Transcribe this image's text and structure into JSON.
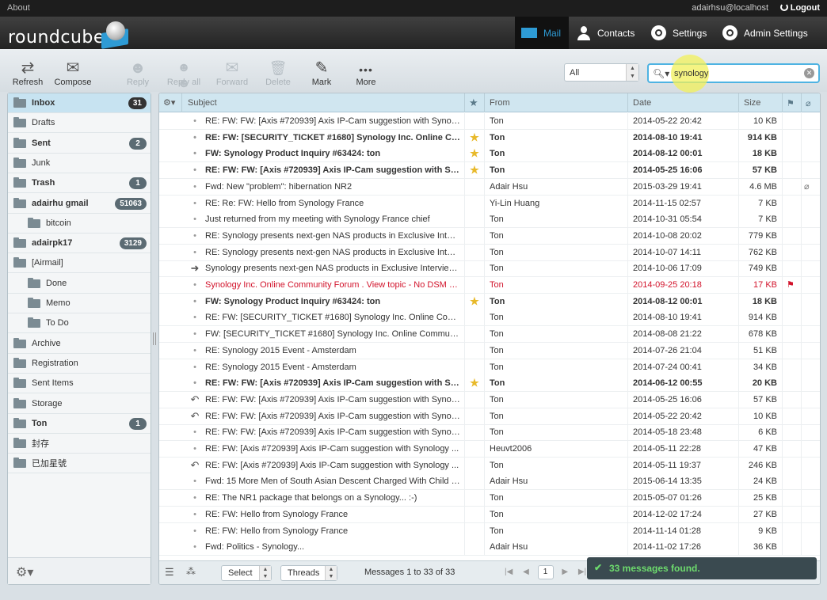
{
  "topbar": {
    "about": "About",
    "user": "adairhsu@localhost",
    "logout": "Logout"
  },
  "header": {
    "logo": "roundcube",
    "nav": [
      {
        "label": "Mail",
        "icon": "mail-icon",
        "active": true
      },
      {
        "label": "Contacts",
        "icon": "person-icon"
      },
      {
        "label": "Settings",
        "icon": "gear-icon"
      },
      {
        "label": "Admin Settings",
        "icon": "gear-icon"
      }
    ]
  },
  "toolbar": {
    "refresh": "Refresh",
    "compose": "Compose",
    "reply": "Reply",
    "reply_all": "Reply all",
    "forward": "Forward",
    "delete": "Delete",
    "mark": "Mark",
    "more": "More"
  },
  "filter": {
    "value": "All"
  },
  "search": {
    "value": "synology"
  },
  "folders": [
    {
      "name": "Inbox",
      "count": "31",
      "bold": true,
      "sel": true
    },
    {
      "name": "Drafts"
    },
    {
      "name": "Sent",
      "count": "2",
      "bold": true
    },
    {
      "name": "Junk"
    },
    {
      "name": "Trash",
      "count": "1",
      "bold": true
    },
    {
      "name": "adairhu gmail",
      "count": "51063",
      "bold": true
    },
    {
      "name": "bitcoin",
      "sub": true
    },
    {
      "name": "adairpk17",
      "count": "3129",
      "bold": true
    },
    {
      "name": "[Airmail]"
    },
    {
      "name": "Done",
      "sub": true
    },
    {
      "name": "Memo",
      "sub": true
    },
    {
      "name": "To Do",
      "sub": true
    },
    {
      "name": "Archive"
    },
    {
      "name": "Registration"
    },
    {
      "name": "Sent Items"
    },
    {
      "name": "Storage"
    },
    {
      "name": "Ton",
      "count": "1",
      "bold": true
    },
    {
      "name": "封存"
    },
    {
      "name": "已加星號"
    }
  ],
  "columns": {
    "subject": "Subject",
    "from": "From",
    "date": "Date",
    "size": "Size"
  },
  "messages": [
    {
      "subject": "RE: FW: FW: [Axis #720939] Axis IP-Cam suggestion with Synolo...",
      "from": "Ton",
      "date": "2014-05-22 20:42",
      "size": "10 KB"
    },
    {
      "subject": "RE: FW: [SECURITY_TICKET #1680] Synology Inc. Online Com...",
      "from": "Ton",
      "date": "2014-08-10 19:41",
      "size": "914 KB",
      "unread": true,
      "star": true
    },
    {
      "subject": "FW: Synology Product Inquiry #63424: ton",
      "from": "Ton",
      "date": "2014-08-12 00:01",
      "size": "18 KB",
      "unread": true,
      "star": true
    },
    {
      "subject": "RE: FW: FW: [Axis #720939] Axis IP-Cam suggestion with Sy...",
      "from": "Ton",
      "date": "2014-05-25 16:06",
      "size": "57 KB",
      "unread": true,
      "star": true
    },
    {
      "subject": "Fwd: New \"problem\": hibernation NR2",
      "from": "Adair Hsu",
      "date": "2015-03-29 19:41",
      "size": "4.6 MB",
      "attach": true
    },
    {
      "subject": "RE: Re: FW: Hello from Synology France",
      "from": "Yi-Lin Huang",
      "date": "2014-11-15 02:57",
      "size": "7 KB"
    },
    {
      "subject": "Just returned from my meeting with Synology France chief",
      "from": "Ton",
      "date": "2014-10-31 05:54",
      "size": "7 KB"
    },
    {
      "subject": "RE: Synology presents next-gen NAS products in Exclusive Inter...",
      "from": "Ton",
      "date": "2014-10-08 20:02",
      "size": "779 KB"
    },
    {
      "subject": "RE: Synology presents next-gen NAS products in Exclusive Inter...",
      "from": "Ton",
      "date": "2014-10-07 14:11",
      "size": "762 KB"
    },
    {
      "subject": "Synology presents next-gen NAS products in Exclusive Interview...",
      "from": "Ton",
      "date": "2014-10-06 17:09",
      "size": "749 KB",
      "status": "forwarded"
    },
    {
      "subject": "Synology Inc. Online Community Forum . View topic - No DSM 5...",
      "from": "Ton",
      "date": "2014-09-25 20:18",
      "size": "17 KB",
      "flagged": true
    },
    {
      "subject": "FW: Synology Product Inquiry #63424: ton",
      "from": "Ton",
      "date": "2014-08-12 00:01",
      "size": "18 KB",
      "unread": true,
      "star": true
    },
    {
      "subject": "RE: FW: [SECURITY_TICKET #1680] Synology Inc. Online Commu...",
      "from": "Ton",
      "date": "2014-08-10 19:41",
      "size": "914 KB"
    },
    {
      "subject": "FW: [SECURITY_TICKET #1680] Synology Inc. Online Community ...",
      "from": "Ton",
      "date": "2014-08-08 21:22",
      "size": "678 KB"
    },
    {
      "subject": "RE: Synology 2015 Event - Amsterdam",
      "from": "Ton",
      "date": "2014-07-26 21:04",
      "size": "51 KB"
    },
    {
      "subject": "RE: Synology 2015 Event - Amsterdam",
      "from": "Ton",
      "date": "2014-07-24 00:41",
      "size": "34 KB"
    },
    {
      "subject": "RE: FW: FW: [Axis #720939] Axis IP-Cam suggestion with Sy...",
      "from": "Ton",
      "date": "2014-06-12 00:55",
      "size": "20 KB",
      "unread": true,
      "star": true
    },
    {
      "subject": "RE: FW: FW: [Axis #720939] Axis IP-Cam suggestion with Synolo...",
      "from": "Ton",
      "date": "2014-05-25 16:06",
      "size": "57 KB",
      "status": "replied"
    },
    {
      "subject": "RE: FW: FW: [Axis #720939] Axis IP-Cam suggestion with Synolo...",
      "from": "Ton",
      "date": "2014-05-22 20:42",
      "size": "10 KB",
      "status": "replied"
    },
    {
      "subject": "RE: FW: FW: [Axis #720939] Axis IP-Cam suggestion with Synolo...",
      "from": "Ton",
      "date": "2014-05-18 23:48",
      "size": "6 KB"
    },
    {
      "subject": "RE: FW: [Axis #720939] Axis IP-Cam suggestion with Synology ...",
      "from": "Heuvt2006",
      "date": "2014-05-11 22:28",
      "size": "47 KB"
    },
    {
      "subject": "RE: FW: [Axis #720939] Axis IP-Cam suggestion with Synology ...",
      "from": "Ton",
      "date": "2014-05-11 19:37",
      "size": "246 KB",
      "status": "replied"
    },
    {
      "subject": "Fwd: 15 More Men of South Asian Descent Charged With Child S...",
      "from": "Adair Hsu",
      "date": "2015-06-14 13:35",
      "size": "24 KB"
    },
    {
      "subject": "RE: The NR1 package that belongs on a Synology... :-)",
      "from": "Ton",
      "date": "2015-05-07 01:26",
      "size": "25 KB"
    },
    {
      "subject": "RE: FW: Hello from Synology France",
      "from": "Ton",
      "date": "2014-12-02 17:24",
      "size": "27 KB"
    },
    {
      "subject": "RE: FW: Hello from Synology France",
      "from": "Ton",
      "date": "2014-11-14 01:28",
      "size": "9 KB"
    },
    {
      "subject": "Fwd: Politics - Synology...",
      "from": "Adair Hsu",
      "date": "2014-11-02 17:26",
      "size": "36 KB"
    }
  ],
  "footer": {
    "select": "Select",
    "threads": "Threads",
    "count_text": "Messages 1 to 33 of 33",
    "page": "1"
  },
  "toast": "33 messages found."
}
